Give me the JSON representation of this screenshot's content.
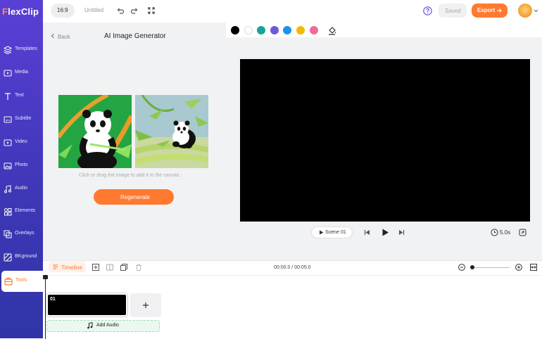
{
  "app": {
    "logo": "FlexClip",
    "logo_prefix": "F",
    "logo_rest": "lexClip"
  },
  "topbar": {
    "aspect_ratio": "16:9",
    "project_title": "Untitled",
    "save_status": "Saved",
    "export_label": "Export"
  },
  "sidebar": {
    "items": [
      {
        "label": "Templates",
        "icon": "templates-icon"
      },
      {
        "label": "Media",
        "icon": "media-icon"
      },
      {
        "label": "Text",
        "icon": "text-icon"
      },
      {
        "label": "Subtitle",
        "icon": "subtitle-icon"
      },
      {
        "label": "Video",
        "icon": "video-icon"
      },
      {
        "label": "Photo",
        "icon": "photo-icon"
      },
      {
        "label": "Audio",
        "icon": "audio-icon"
      },
      {
        "label": "Elements",
        "icon": "elements-icon"
      },
      {
        "label": "Overlays",
        "icon": "overlays-icon"
      },
      {
        "label": "BKground",
        "icon": "background-icon"
      },
      {
        "label": "Tools",
        "icon": "tools-icon",
        "active": true
      }
    ]
  },
  "panel": {
    "back_label": "Back",
    "title": "AI Image Generator",
    "hint": "Click or drag the image to add it to the canvas.",
    "regenerate_label": "Regenerate"
  },
  "color_swatches": [
    "#000000",
    "#ffffff",
    "#1aa39a",
    "#6b5bd6",
    "#1e90e8",
    "#f5b800",
    "#f06a9a"
  ],
  "player": {
    "scene_label": "Scene",
    "scene_number": "01",
    "duration": "5.0s"
  },
  "timeline": {
    "label": "Timeline",
    "time": "00:00.0 / 00:05.0",
    "zoom_level": 0.05,
    "clip_number": "01",
    "add_audio_label": "Add Audio"
  },
  "colors": {
    "accent": "#ff7a30",
    "sidebar": "#4a3cc8",
    "help": "#5b4de0"
  }
}
